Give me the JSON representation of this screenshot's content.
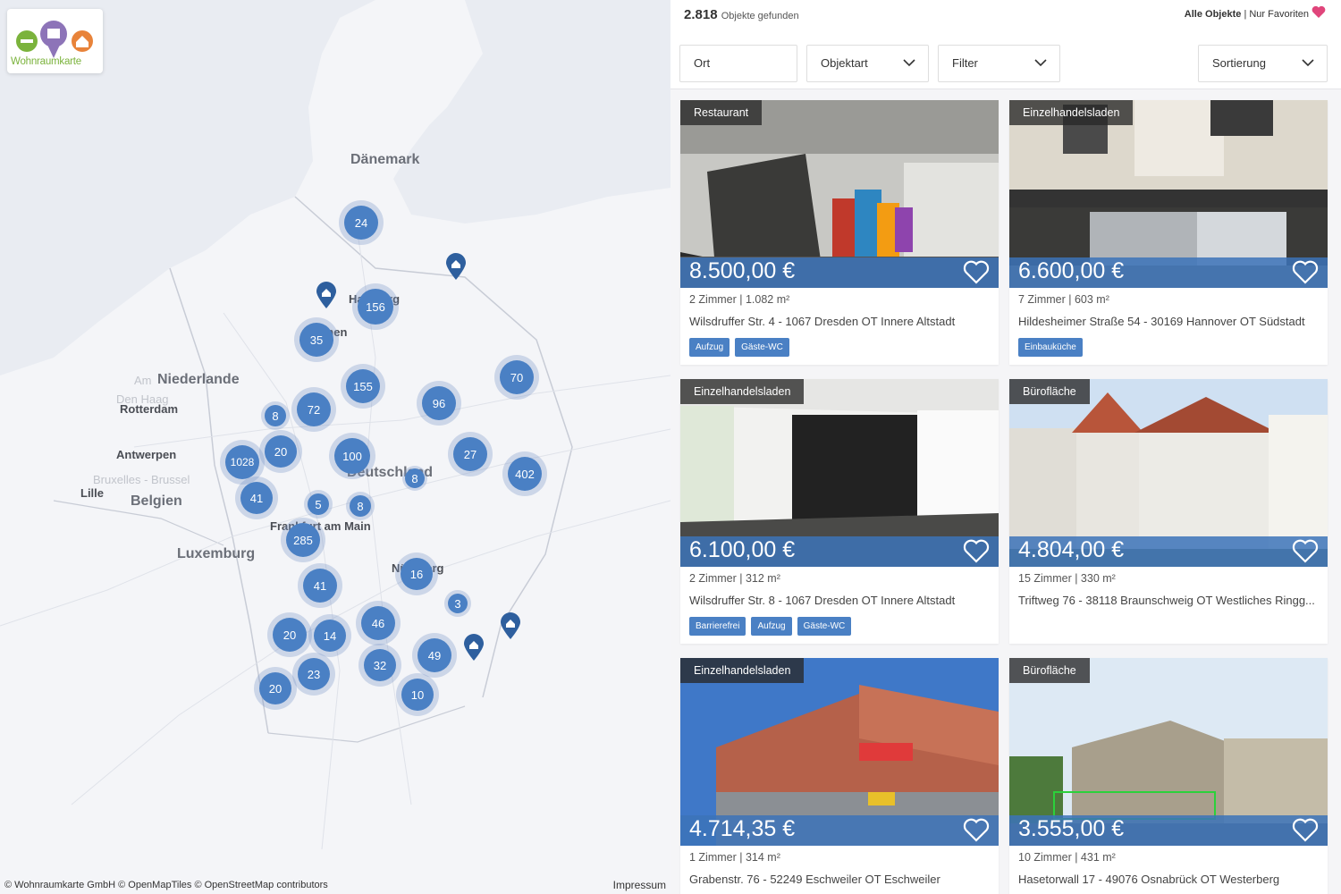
{
  "app": {
    "logo_text": "Wohnraumkarte"
  },
  "map": {
    "labels": {
      "daenemark": "Dänemark",
      "niederlande": "Niederlande",
      "belgien": "Belgien",
      "luxemburg": "Luxemburg",
      "deutschland": "Deutschland",
      "rotterdam": "Rotterdam",
      "antwerpen": "Antwerpen",
      "lille": "Lille",
      "hamburg": "Hamburg",
      "bremen": "Bremen",
      "frankfurt": "Frankfurt am Main",
      "nuernberg": "Nürnberg",
      "den_haag": "Den Haag",
      "amsterdam": "Am",
      "bruxelles": "Bruxelles - Brussel"
    },
    "clusters": [
      {
        "count": "24"
      },
      {
        "count": "156"
      },
      {
        "count": "35"
      },
      {
        "count": "155"
      },
      {
        "count": "70"
      },
      {
        "count": "8"
      },
      {
        "count": "72"
      },
      {
        "count": "96"
      },
      {
        "count": "20"
      },
      {
        "count": "1028"
      },
      {
        "count": "100"
      },
      {
        "count": "27"
      },
      {
        "count": "402"
      },
      {
        "count": "41"
      },
      {
        "count": "5"
      },
      {
        "count": "8"
      },
      {
        "count": "8"
      },
      {
        "count": "285"
      },
      {
        "count": "16"
      },
      {
        "count": "41"
      },
      {
        "count": "3"
      },
      {
        "count": "46"
      },
      {
        "count": "20"
      },
      {
        "count": "14"
      },
      {
        "count": "49"
      },
      {
        "count": "32"
      },
      {
        "count": "23"
      },
      {
        "count": "20"
      },
      {
        "count": "10"
      }
    ],
    "attribution": "© Wohnraumkarte GmbH © OpenMapTiles © OpenStreetMap contributors",
    "impressum": "Impressum"
  },
  "list": {
    "count_value": "2.818",
    "count_label": "Objekte gefunden",
    "all_objects": "Alle Objekte",
    "separator": "|",
    "only_favorites": "Nur Favoriten",
    "filters": {
      "ort": "Ort",
      "objektart": "Objektart",
      "filter": "Filter",
      "sortierung": "Sortierung"
    },
    "colors": {
      "accent": "#4a80c4",
      "favorite": "#e0457b"
    },
    "cards": [
      {
        "type": "Restaurant",
        "price": "8.500,00 €",
        "meta": "2 Zimmer | 1.082 m²",
        "address": "Wilsdruffer Str. 4 - 1067 Dresden OT Innere Altstadt",
        "tags": [
          "Aufzug",
          "Gäste-WC"
        ]
      },
      {
        "type": "Einzelhandelsladen",
        "price": "6.600,00 €",
        "meta": "7 Zimmer | 603 m²",
        "address": "Hildesheimer Straße 54 - 30169 Hannover OT Südstadt",
        "tags": [
          "Einbauküche"
        ]
      },
      {
        "type": "Einzelhandelsladen",
        "price": "6.100,00 €",
        "meta": "2 Zimmer | 312 m²",
        "address": "Wilsdruffer Str. 8 - 1067 Dresden OT Innere Altstadt",
        "tags": [
          "Barrierefrei",
          "Aufzug",
          "Gäste-WC"
        ]
      },
      {
        "type": "Bürofläche",
        "price": "4.804,00 €",
        "meta": "15 Zimmer | 330 m²",
        "address": "Triftweg 76 - 38118 Braunschweig OT Westliches Ringg...",
        "tags": []
      },
      {
        "type": "Einzelhandelsladen",
        "price": "4.714,35 €",
        "meta": "1 Zimmer | 314 m²",
        "address": "Grabenstr. 76 - 52249 Eschweiler OT Eschweiler",
        "tags": []
      },
      {
        "type": "Bürofläche",
        "price": "3.555,00 €",
        "meta": "10 Zimmer | 431 m²",
        "address": "Hasetorwall 17 - 49076 Osnabrück OT Westerberg",
        "tags": []
      }
    ]
  }
}
